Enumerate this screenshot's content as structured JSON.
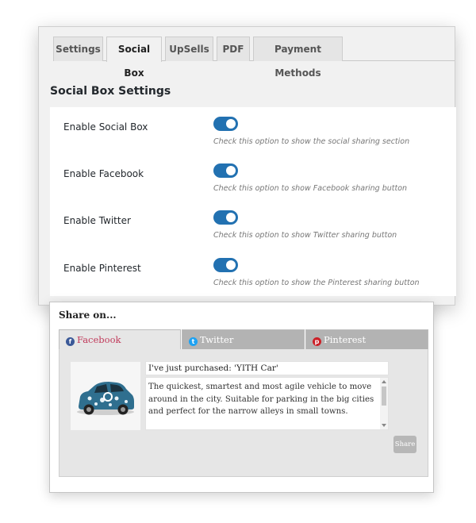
{
  "settings": {
    "tabs": [
      {
        "label": "Settings"
      },
      {
        "label": "Social Box"
      },
      {
        "label": "UpSells"
      },
      {
        "label": "PDF"
      },
      {
        "label": "Payment Methods"
      }
    ],
    "active_tab": "Social Box",
    "section_title": "Social Box Settings",
    "options": [
      {
        "label": "Enable Social Box",
        "enabled": true,
        "description": "Check this option to show the social sharing section"
      },
      {
        "label": "Enable Facebook",
        "enabled": true,
        "description": "Check this option to show Facebook sharing button"
      },
      {
        "label": "Enable Twitter",
        "enabled": true,
        "description": "Check this option to show Twitter sharing button"
      },
      {
        "label": "Enable Pinterest",
        "enabled": true,
        "description": "Check this option to show the Pinterest sharing button"
      }
    ],
    "toggle_color": "#2271b1"
  },
  "share_box": {
    "title": "Share on...",
    "tabs": [
      {
        "label": "Facebook",
        "icon": "facebook-icon",
        "color": "#3b5998"
      },
      {
        "label": "Twitter",
        "icon": "twitter-icon",
        "color": "#1da1f2"
      },
      {
        "label": "Pinterest",
        "icon": "pinterest-icon",
        "color": "#cb2027"
      }
    ],
    "active_tab": "Facebook",
    "product_image": "car-thumbnail",
    "message_title": "I've just purchased: 'YITH Car'",
    "message_body": "The quickest, smartest and most agile vehicle to move around in the city. Suitable for parking in the big cities and perfect for the narrow alleys in small towns.",
    "share_button": "Share"
  }
}
